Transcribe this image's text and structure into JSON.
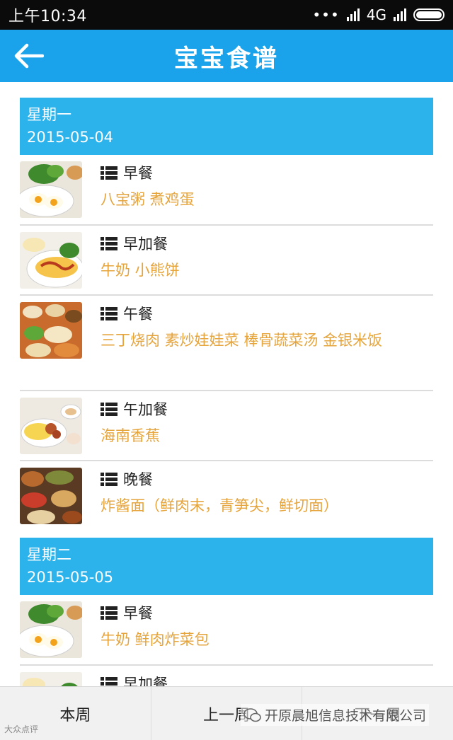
{
  "status_bar": {
    "time": "上午10:34",
    "network": "4G"
  },
  "app_bar": {
    "title": "宝宝食谱",
    "back_icon": "arrow-left-icon"
  },
  "days": [
    {
      "day_name": "星期一",
      "date": "2015-05-04",
      "meals": [
        {
          "name": "早餐",
          "items": "八宝粥 煮鸡蛋",
          "image": "breakfast-eggs"
        },
        {
          "name": "早加餐",
          "items": "牛奶 小熊饼",
          "image": "omelette"
        },
        {
          "name": "午餐",
          "items": "三丁烧肉 素炒娃娃菜 棒骨蔬菜汤 金银米饭",
          "image": "lunch-table"
        },
        {
          "name": "午加餐",
          "items": "海南香蕉",
          "image": "snack-plate"
        },
        {
          "name": "晚餐",
          "items": "炸酱面（鲜肉末，青笋尖，鲜切面）",
          "image": "dinner-spread"
        }
      ]
    },
    {
      "day_name": "星期二",
      "date": "2015-05-05",
      "meals": [
        {
          "name": "早餐",
          "items": "牛奶 鲜肉炸菜包",
          "image": "breakfast-eggs"
        },
        {
          "name": "早加餐",
          "items": "",
          "image": "omelette"
        }
      ]
    }
  ],
  "bottom_tabs": [
    "本周",
    "上一周",
    "下一周"
  ],
  "watermark": {
    "text": "开原晨旭信息技术有限公司",
    "left_text": "大众点评"
  },
  "colors": {
    "app_bar": "#1aa3ea",
    "day_header": "#2cb3ec",
    "meal_items": "#e6a43c"
  }
}
